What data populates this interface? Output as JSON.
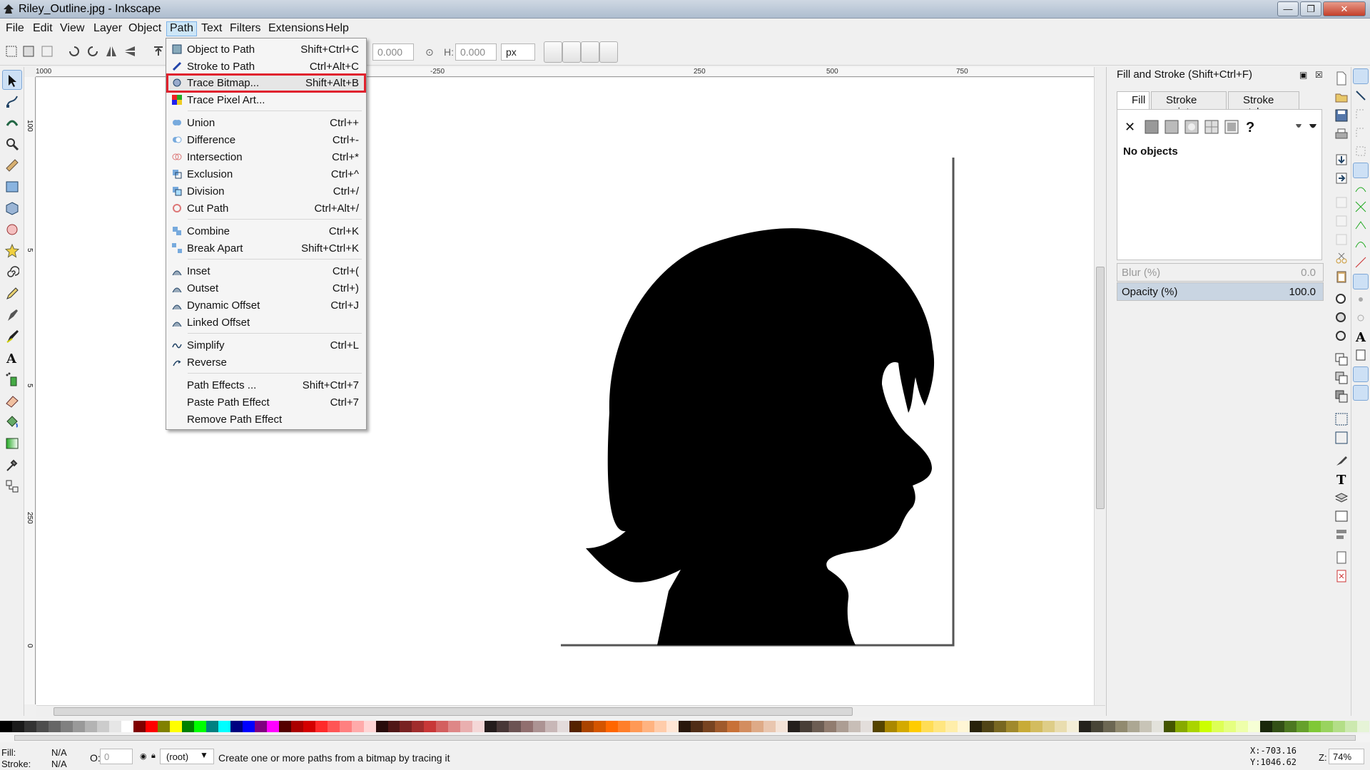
{
  "window": {
    "title": "Riley_Outline.jpg - Inkscape",
    "controls": {
      "minimize": "—",
      "maximize": "❐",
      "close": "✕"
    }
  },
  "menubar": [
    "File",
    "Edit",
    "View",
    "Layer",
    "Object",
    "Path",
    "Text",
    "Filters",
    "Extensions",
    "Help"
  ],
  "toolcontrols": {
    "y_value": "0.000",
    "h_label": "H:",
    "h_value": "0.000",
    "unit": "px"
  },
  "ruler": {
    "h_ticks": [
      "1000",
      "-250",
      "250",
      "500",
      "750"
    ],
    "v_ticks": [
      "100",
      "5",
      "5",
      "250",
      "0"
    ]
  },
  "path_menu": [
    {
      "label": "Object to Path",
      "shortcut": "Shift+Ctrl+C",
      "icon": "object-to-path-icon"
    },
    {
      "label": "Stroke to Path",
      "shortcut": "Ctrl+Alt+C",
      "icon": "stroke-to-path-icon"
    },
    {
      "label": "Trace Bitmap...",
      "shortcut": "Shift+Alt+B",
      "icon": "trace-bitmap-icon",
      "highlight": true
    },
    {
      "label": "Trace Pixel Art...",
      "shortcut": "",
      "icon": "trace-pixel-art-icon"
    },
    {
      "label": "Union",
      "shortcut": "Ctrl++",
      "icon": "union-icon"
    },
    {
      "label": "Difference",
      "shortcut": "Ctrl+-",
      "icon": "difference-icon"
    },
    {
      "label": "Intersection",
      "shortcut": "Ctrl+*",
      "icon": "intersection-icon"
    },
    {
      "label": "Exclusion",
      "shortcut": "Ctrl+^",
      "icon": "exclusion-icon"
    },
    {
      "label": "Division",
      "shortcut": "Ctrl+/",
      "icon": "division-icon"
    },
    {
      "label": "Cut Path",
      "shortcut": "Ctrl+Alt+/",
      "icon": "cut-path-icon"
    },
    {
      "label": "Combine",
      "shortcut": "Ctrl+K",
      "icon": "combine-icon"
    },
    {
      "label": "Break Apart",
      "shortcut": "Shift+Ctrl+K",
      "icon": "break-apart-icon"
    },
    {
      "label": "Inset",
      "shortcut": "Ctrl+(",
      "icon": "inset-icon"
    },
    {
      "label": "Outset",
      "shortcut": "Ctrl+)",
      "icon": "outset-icon"
    },
    {
      "label": "Dynamic Offset",
      "shortcut": "Ctrl+J",
      "icon": "dynamic-offset-icon"
    },
    {
      "label": "Linked Offset",
      "shortcut": "",
      "icon": "linked-offset-icon"
    },
    {
      "label": "Simplify",
      "shortcut": "Ctrl+L",
      "icon": "simplify-icon"
    },
    {
      "label": "Reverse",
      "shortcut": "",
      "icon": "reverse-icon"
    },
    {
      "label": "Path Effects ...",
      "shortcut": "Shift+Ctrl+7",
      "icon": ""
    },
    {
      "label": "Paste Path Effect",
      "shortcut": "Ctrl+7",
      "icon": ""
    },
    {
      "label": "Remove Path Effect",
      "shortcut": "",
      "icon": ""
    }
  ],
  "dock": {
    "title": "Fill and Stroke (Shift+Ctrl+F)",
    "tabs": [
      "Fill",
      "Stroke paint",
      "Stroke style"
    ],
    "no_objects": "No objects",
    "blur_label": "Blur (%)",
    "blur_value": "0.0",
    "opacity_label": "Opacity (%)",
    "opacity_value": "100.0",
    "unset_glyph": "✕",
    "unknown_glyph": "?"
  },
  "statusbar": {
    "fill_label": "Fill:",
    "fill_value": "N/A",
    "stroke_label": "Stroke:",
    "stroke_value": "N/A",
    "opacity_label": "O:",
    "opacity_value": "0",
    "layer": "(root)",
    "message": "Create one or more paths from a bitmap by tracing it",
    "x_coord": "X:-703.16",
    "y_coord": "Y:1046.62",
    "zoom_label": "Z:",
    "zoom_value": "74%"
  },
  "colors": {
    "highlight_outline": "#e0222e",
    "selection_bg": "#cde0f5"
  },
  "palette": [
    "#000000",
    "#1a1a1a",
    "#333333",
    "#4d4d4d",
    "#666666",
    "#808080",
    "#999999",
    "#b3b3b3",
    "#cccccc",
    "#e6e6e6",
    "#ffffff",
    "#800000",
    "#ff0000",
    "#808000",
    "#ffff00",
    "#008000",
    "#00ff00",
    "#008080",
    "#00ffff",
    "#000080",
    "#0000ff",
    "#800080",
    "#ff00ff",
    "#550000",
    "#aa0000",
    "#d40000",
    "#ff2a2a",
    "#ff5555",
    "#ff8080",
    "#ffaaaa",
    "#ffd5d5",
    "#280b0b",
    "#501616",
    "#782121",
    "#a02c2c",
    "#c83737",
    "#d35f5f",
    "#de8787",
    "#e9afaf",
    "#f4d7d7",
    "#241c1c",
    "#483737",
    "#6c5353",
    "#916f6f",
    "#ac9393",
    "#c8b7b7",
    "#e3dbdb",
    "#552200",
    "#aa4400",
    "#d45500",
    "#ff6600",
    "#ff7f2a",
    "#ff9955",
    "#ffb380",
    "#ffccaa",
    "#ffe6d5",
    "#28170b",
    "#502d16",
    "#784421",
    "#a05a2c",
    "#c87137",
    "#d38d5f",
    "#deaa87",
    "#e9c6af",
    "#f4e3d7",
    "#241f1c",
    "#483e37",
    "#6c5d53",
    "#917c6f",
    "#ac9d93",
    "#c8beb7",
    "#e3dedb",
    "#554400",
    "#aa8800",
    "#d4aa00",
    "#ffcc00",
    "#ffdd55",
    "#ffe680",
    "#ffeeaa",
    "#fff6d5",
    "#28220b",
    "#504416",
    "#786721",
    "#a0892c",
    "#c8ab37",
    "#d3bc5f",
    "#decd87",
    "#e9ddaf",
    "#f4eed7",
    "#24221c",
    "#484537",
    "#6c6753",
    "#918a6f",
    "#aca793",
    "#c8c4b7",
    "#e3e2db",
    "#445500",
    "#88aa00",
    "#aad400",
    "#ccff00",
    "#ddff55",
    "#e5ff80",
    "#eeffaa",
    "#f6ffd5",
    "#1a280b",
    "#335016",
    "#4d7821",
    "#66a02c",
    "#80c837",
    "#99d35f",
    "#b3de87",
    "#cce9af",
    "#e6f4d7"
  ]
}
